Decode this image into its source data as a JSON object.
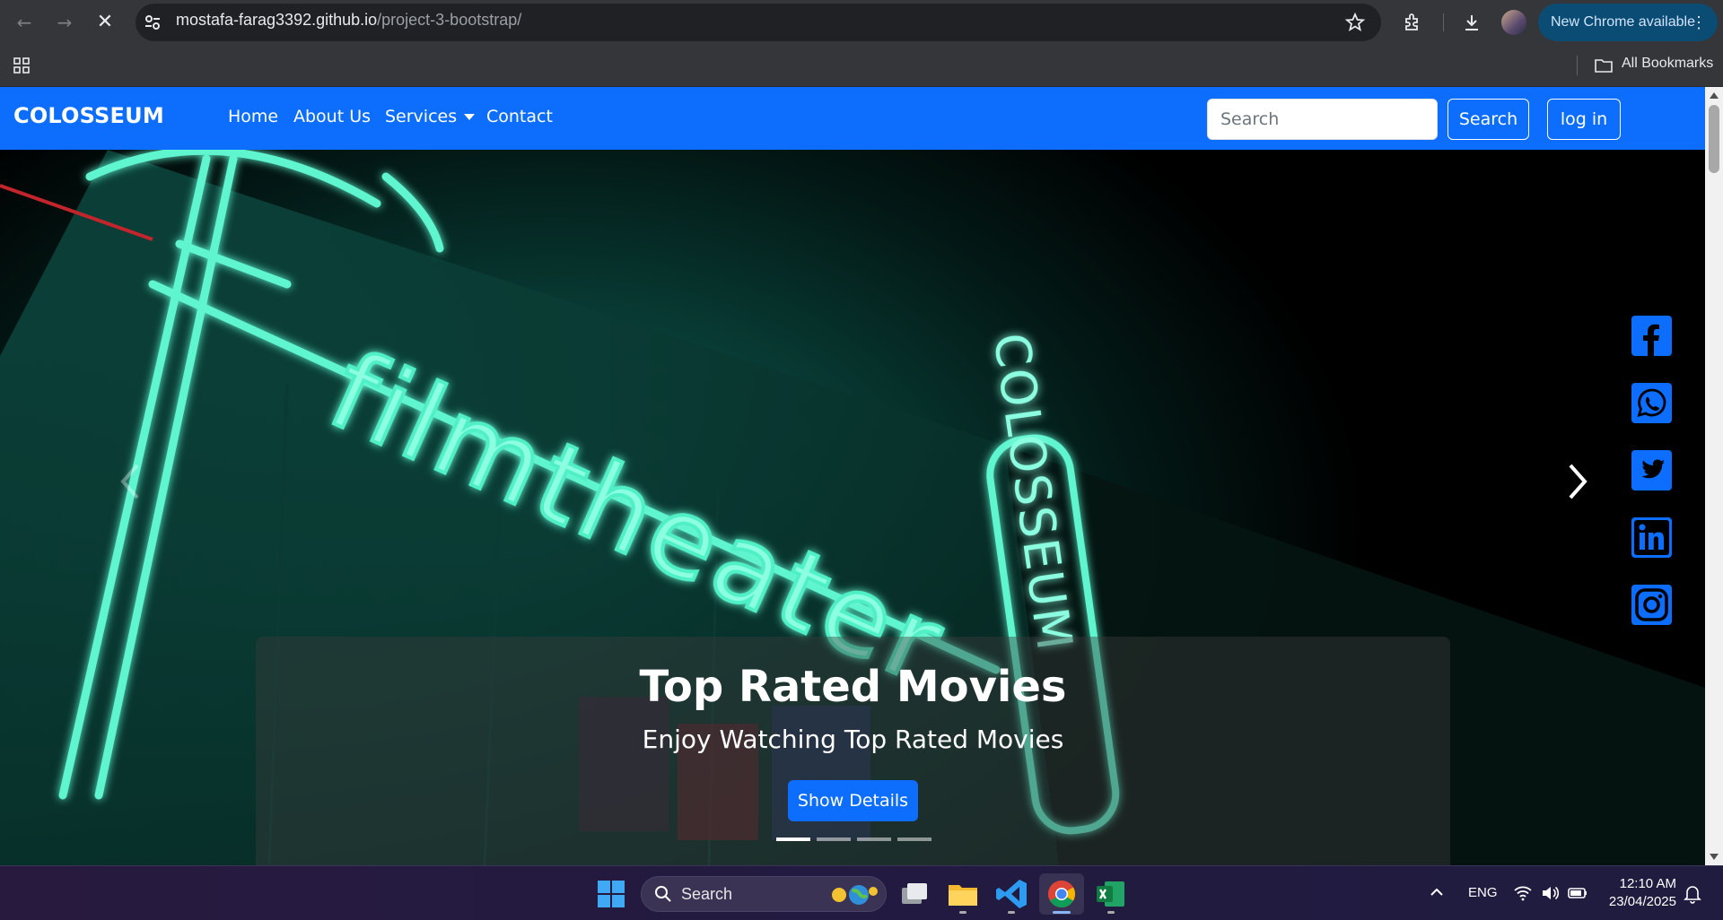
{
  "browser": {
    "url_host": "mostafa-farag3392.github.io",
    "url_path": "/project-3-bootstrap/",
    "update_label": "New Chrome available",
    "bookmarks_label": "All Bookmarks"
  },
  "site": {
    "brand": "COLOSSEUM",
    "nav": {
      "home": "Home",
      "about": "About Us",
      "services": "Services",
      "contact": "Contact"
    },
    "search": {
      "placeholder": "Search",
      "button": "Search"
    },
    "login": "log in",
    "colors": {
      "primary": "#0d6efd"
    }
  },
  "hero": {
    "neon_text": "filmtheater",
    "neon_sign": "COLOSSEUM",
    "caption_title": "Top Rated Movies",
    "caption_subtitle": "Enjoy Watching Top Rated Movies",
    "caption_button": "Show Details",
    "indicator_count": 4,
    "active_indicator": 0
  },
  "social": [
    "facebook-icon",
    "whatsapp-icon",
    "twitter-icon",
    "linkedin-icon",
    "instagram-icon"
  ],
  "taskbar": {
    "search": "Search",
    "lang": "ENG",
    "time": "12:10 AM",
    "date": "23/04/2025"
  }
}
